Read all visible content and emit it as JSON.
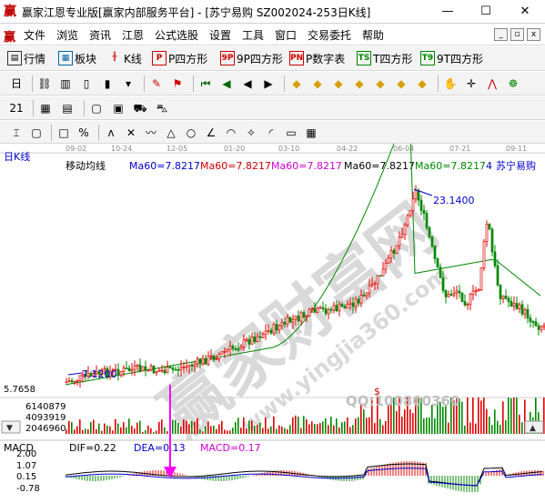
{
  "window": {
    "app_icon": "赢",
    "title": "赢家江恩专业版[赢家内部服务平台] - [苏宁易购   SZ002024-253日K线]",
    "min_label": "—",
    "max_label": "☐",
    "close_label": "✕"
  },
  "menu": {
    "app_icon": "赢",
    "items": [
      "文件",
      "浏览",
      "资讯",
      "江恩",
      "公式选股",
      "设置",
      "工具",
      "窗口",
      "交易委托",
      "帮助"
    ],
    "mdi_buttons": [
      "_",
      "▫",
      "x"
    ]
  },
  "toolbar1": {
    "items": [
      {
        "icon": "market-icon",
        "glyph": "▤",
        "label": "行情"
      },
      {
        "icon": "sector-icon",
        "glyph": "▦",
        "label": "板块"
      },
      {
        "icon": "kline-icon",
        "glyph": "╫",
        "label": "K线"
      },
      {
        "icon": "p-chart-icon",
        "glyph": "P",
        "label": "P四方形"
      },
      {
        "icon": "9p-chart-icon",
        "glyph": "9P",
        "label": "9P四方形"
      },
      {
        "icon": "pn-icon",
        "glyph": "PN",
        "label": "P数字表"
      },
      {
        "icon": "ts-icon",
        "glyph": "TS",
        "label": "T四方形"
      },
      {
        "icon": "9t-icon",
        "glyph": "T9",
        "label": "9T四方形"
      }
    ]
  },
  "toolbar2": {
    "icons": [
      "period-icon",
      "link-icon",
      "chart-type-icon",
      "candle-icon",
      "bar-icon",
      "dropdown-icon",
      "draw-icon",
      "flag-icon",
      "first-icon",
      "prev-page-icon",
      "prev-icon",
      "next-icon",
      "diamond-up-icon",
      "diamond-left-icon",
      "diamond-both-icon",
      "diamond-right-icon",
      "diamond-down-icon",
      "diamond-x-icon",
      "diamond-plus-icon",
      "hand-icon",
      "crosshair-icon",
      "indicator-icon",
      "gann-icon"
    ],
    "glyphs": [
      "日",
      "⛓",
      "▥",
      "▯",
      "▮",
      "▾",
      "✎",
      "⚑",
      "⏮",
      "◀",
      "◀",
      "▶",
      "◆",
      "◆",
      "◆",
      "◆",
      "◆",
      "◆",
      "◆",
      "✋",
      "✛",
      "⋀",
      "☸"
    ]
  },
  "toolbar3": {
    "icons": [
      "calendar-icon",
      "calculator-icon",
      "table-icon",
      "window-icon",
      "monitor-icon",
      "truck-icon",
      "car-icon"
    ],
    "glyphs": [
      "21",
      "▦",
      "▤",
      "▢",
      "▣",
      "⛟",
      "⛍"
    ]
  },
  "toolbar4": {
    "icons": [
      "pointer-icon",
      "pattern-icon",
      "square-icon",
      "percent-icon",
      "zigzag-icon",
      "cross-icon",
      "wave-icon",
      "triangle-icon",
      "circle-line-icon",
      "angle-icon",
      "fan-icon",
      "star-icon",
      "arc-icon",
      "box-icon",
      "grid-icon"
    ],
    "glyphs": [
      "⌶",
      "▢",
      "□",
      "%",
      "ʌ",
      "✕",
      "〰",
      "△",
      "○",
      "∠",
      "◠",
      "✧",
      "◜",
      "▭",
      "▦"
    ]
  },
  "chart": {
    "period_label": "日K线",
    "ma_header": "移动均线",
    "ma_values": [
      {
        "text": "Ma60=7.8217",
        "color": "#0000cc"
      },
      {
        "text": "Ma60=7.8217",
        "color": "#cc0000"
      },
      {
        "text": "Ma60=7.8217",
        "color": "#cc00cc"
      },
      {
        "text": "Ma60=7.8217",
        "color": "#000000"
      },
      {
        "text": "Ma60=7.8217",
        "color": "#008800"
      }
    ],
    "stock_tag": "4",
    "stock_name": "苏宁易购",
    "dates": [
      "09-02",
      "10-24",
      "12-05",
      "01-20",
      "03-10",
      "04-22",
      "06-04",
      "07-21",
      "09-11"
    ],
    "high_label": "23.1400",
    "low_label": "7.1200",
    "low_price_axis": "5.7658",
    "volume_axis": [
      "6140879",
      "4093919",
      "2046960"
    ],
    "macd_title": "MACD",
    "dif_text": "DIF=0.22",
    "dea_text": "DEA=0.13",
    "macd_text": "MACD=0.17",
    "macd_axis": [
      "2.00",
      "1.07",
      "0.15",
      "-0.78"
    ],
    "dollar_mark": "$",
    "qq_text": "QQ:100800360",
    "watermark_cn": "赢家财富网",
    "watermark_url": "www.yingjia360.com",
    "colors": {
      "up": "#e00000",
      "down": "#008800",
      "ma": "#008800",
      "text_blue": "#0000cc",
      "arrow": "#ff00ff"
    }
  }
}
